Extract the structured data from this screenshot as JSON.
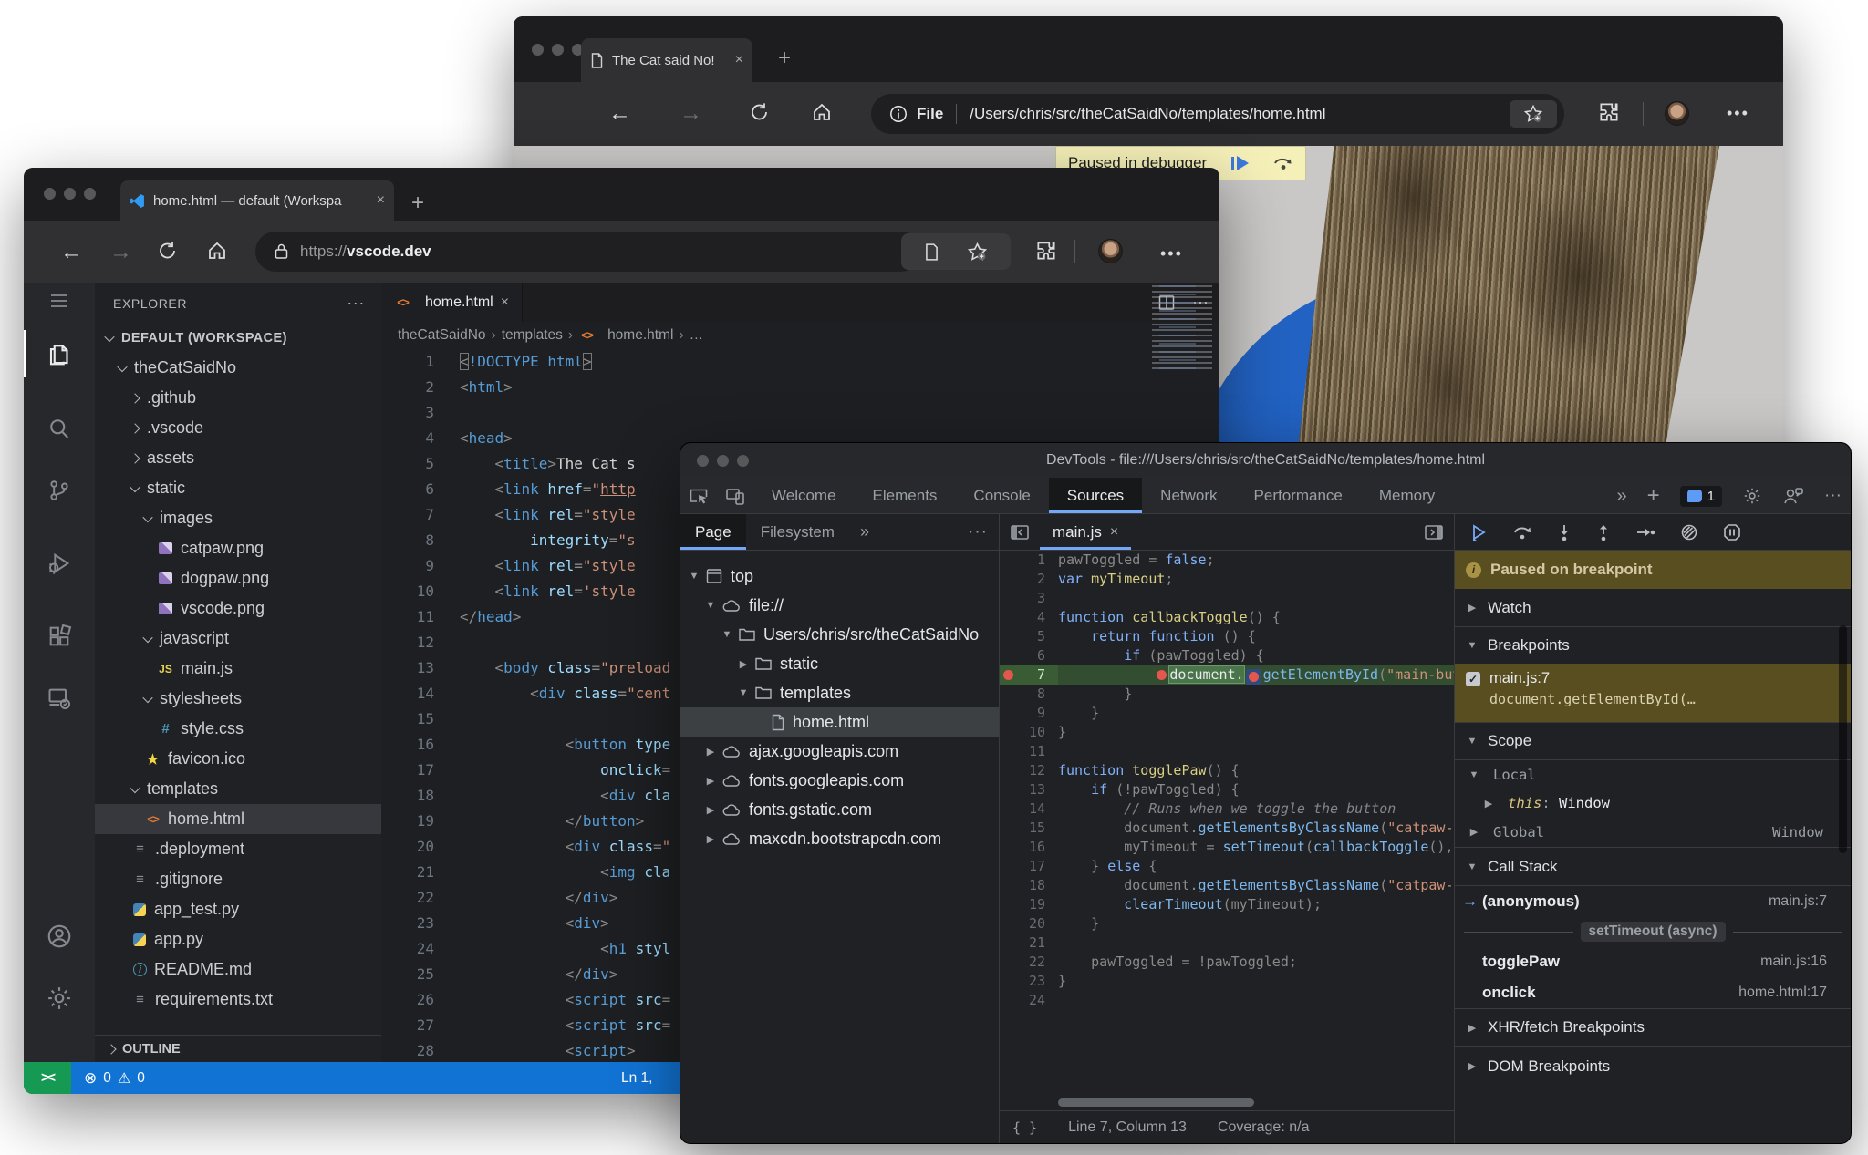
{
  "browser_top": {
    "tab_title": "The Cat said No!",
    "close_glyph": "×",
    "new_tab_glyph": "+",
    "address": {
      "scheme_label": "File",
      "path": "/Users/chris/src/theCatSaidNo/templates/home.html"
    },
    "banner": {
      "text": "Paused in debugger"
    },
    "menu_glyph": "•••"
  },
  "vscode_browser": {
    "tab_title": "home.html — default (Workspa",
    "close_glyph": "×",
    "new_tab_glyph": "+",
    "address": {
      "scheme": "https://",
      "host": "vscode.dev"
    },
    "menu_glyph": "•••"
  },
  "vscode": {
    "explorer_header": "EXPLORER",
    "header_menu_glyph": "···",
    "outline_label": "OUTLINE",
    "tree": [
      {
        "label": "DEFAULT (WORKSPACE)",
        "chev": "down",
        "indent": 0,
        "bold": true
      },
      {
        "label": "theCatSaidNo",
        "chev": "down",
        "indent": 1
      },
      {
        "label": ".github",
        "chev": "right",
        "indent": 2
      },
      {
        "label": ".vscode",
        "chev": "right",
        "indent": 2
      },
      {
        "label": "assets",
        "chev": "right",
        "indent": 2
      },
      {
        "label": "static",
        "chev": "down",
        "indent": 2
      },
      {
        "label": "images",
        "chev": "down",
        "indent": 3
      },
      {
        "label": "catpaw.png",
        "icon": "image",
        "indent": 4
      },
      {
        "label": "dogpaw.png",
        "icon": "image",
        "indent": 4
      },
      {
        "label": "vscode.png",
        "icon": "image",
        "indent": 4
      },
      {
        "label": "javascript",
        "chev": "down",
        "indent": 3
      },
      {
        "label": "main.js",
        "icon": "js",
        "indent": 4
      },
      {
        "label": "stylesheets",
        "chev": "down",
        "indent": 3
      },
      {
        "label": "style.css",
        "icon": "css",
        "indent": 4
      },
      {
        "label": "favicon.ico",
        "icon": "star",
        "indent": 3
      },
      {
        "label": "templates",
        "chev": "down",
        "indent": 2
      },
      {
        "label": "home.html",
        "icon": "html",
        "indent": 3,
        "selected": true
      },
      {
        "label": ".deployment",
        "icon": "list",
        "indent": 2
      },
      {
        "label": ".gitignore",
        "icon": "list",
        "indent": 2
      },
      {
        "label": "app_test.py",
        "icon": "py",
        "indent": 2
      },
      {
        "label": "app.py",
        "icon": "py",
        "indent": 2
      },
      {
        "label": "README.md",
        "icon": "info",
        "indent": 2
      },
      {
        "label": "requirements.txt",
        "icon": "list",
        "indent": 2
      }
    ],
    "editor": {
      "tab_label": "home.html",
      "tab_icon_glyph": "<>",
      "close_glyph": "×",
      "actions_menu_glyph": "···",
      "breadcrumbs": [
        "theCatSaidNo",
        "templates",
        "home.html",
        "…"
      ],
      "lines": [
        [
          [
            "b",
            "<"
          ],
          [
            "t",
            "!DOCTYPE"
          ],
          [
            "w",
            " "
          ],
          [
            "t",
            "html"
          ],
          [
            "b",
            ">"
          ]
        ],
        [
          [
            "p",
            "<"
          ],
          [
            "t",
            "html"
          ],
          [
            "p",
            ">"
          ]
        ],
        [],
        [
          [
            "p",
            "<"
          ],
          [
            "t",
            "head"
          ],
          [
            "p",
            ">"
          ]
        ],
        [
          [
            "w",
            "    "
          ],
          [
            "p",
            "<"
          ],
          [
            "t",
            "title"
          ],
          [
            "p",
            ">"
          ],
          [
            "w",
            "The Cat s"
          ]
        ],
        [
          [
            "w",
            "    "
          ],
          [
            "p",
            "<"
          ],
          [
            "t",
            "link"
          ],
          [
            "w",
            " "
          ],
          [
            "a",
            "href"
          ],
          [
            "p",
            "="
          ],
          [
            "s",
            "\""
          ],
          [
            "u",
            "http"
          ]
        ],
        [
          [
            "w",
            "    "
          ],
          [
            "p",
            "<"
          ],
          [
            "t",
            "link"
          ],
          [
            "w",
            " "
          ],
          [
            "a",
            "rel"
          ],
          [
            "p",
            "="
          ],
          [
            "s",
            "\"style"
          ]
        ],
        [
          [
            "w",
            "        "
          ],
          [
            "a",
            "integrity"
          ],
          [
            "p",
            "="
          ],
          [
            "s",
            "\"s"
          ]
        ],
        [
          [
            "w",
            "    "
          ],
          [
            "p",
            "<"
          ],
          [
            "t",
            "link"
          ],
          [
            "w",
            " "
          ],
          [
            "a",
            "rel"
          ],
          [
            "p",
            "="
          ],
          [
            "s",
            "\"style"
          ]
        ],
        [
          [
            "w",
            "    "
          ],
          [
            "p",
            "<"
          ],
          [
            "t",
            "link"
          ],
          [
            "w",
            " "
          ],
          [
            "a",
            "rel"
          ],
          [
            "p",
            "="
          ],
          [
            "s",
            "'style"
          ]
        ],
        [
          [
            "p",
            "</"
          ],
          [
            "t",
            "head"
          ],
          [
            "p",
            ">"
          ]
        ],
        [],
        [
          [
            "w",
            "    "
          ],
          [
            "p",
            "<"
          ],
          [
            "t",
            "body"
          ],
          [
            "w",
            " "
          ],
          [
            "a",
            "class"
          ],
          [
            "p",
            "="
          ],
          [
            "s",
            "\"preload"
          ]
        ],
        [
          [
            "w",
            "        "
          ],
          [
            "p",
            "<"
          ],
          [
            "t",
            "div"
          ],
          [
            "w",
            " "
          ],
          [
            "a",
            "class"
          ],
          [
            "p",
            "="
          ],
          [
            "s",
            "\"cent"
          ]
        ],
        [],
        [
          [
            "w",
            "            "
          ],
          [
            "p",
            "<"
          ],
          [
            "t",
            "button"
          ],
          [
            "w",
            " "
          ],
          [
            "a",
            "type"
          ]
        ],
        [
          [
            "w",
            "                "
          ],
          [
            "a",
            "onclick"
          ],
          [
            "p",
            "="
          ]
        ],
        [
          [
            "w",
            "                "
          ],
          [
            "p",
            "<"
          ],
          [
            "t",
            "div"
          ],
          [
            "w",
            " "
          ],
          [
            "a",
            "cla"
          ]
        ],
        [
          [
            "w",
            "            "
          ],
          [
            "p",
            "</"
          ],
          [
            "t",
            "button"
          ],
          [
            "p",
            ">"
          ]
        ],
        [
          [
            "w",
            "            "
          ],
          [
            "p",
            "<"
          ],
          [
            "t",
            "div"
          ],
          [
            "w",
            " "
          ],
          [
            "a",
            "class"
          ],
          [
            "p",
            "="
          ],
          [
            "s",
            "\""
          ]
        ],
        [
          [
            "w",
            "                "
          ],
          [
            "p",
            "<"
          ],
          [
            "t",
            "img"
          ],
          [
            "w",
            " "
          ],
          [
            "a",
            "cla"
          ]
        ],
        [
          [
            "w",
            "            "
          ],
          [
            "p",
            "</"
          ],
          [
            "t",
            "div"
          ],
          [
            "p",
            ">"
          ]
        ],
        [
          [
            "w",
            "            "
          ],
          [
            "p",
            "<"
          ],
          [
            "t",
            "div"
          ],
          [
            "p",
            ">"
          ]
        ],
        [
          [
            "w",
            "                "
          ],
          [
            "p",
            "<"
          ],
          [
            "t",
            "h1"
          ],
          [
            "w",
            " "
          ],
          [
            "a",
            "styl"
          ]
        ],
        [
          [
            "w",
            "            "
          ],
          [
            "p",
            "</"
          ],
          [
            "t",
            "div"
          ],
          [
            "p",
            ">"
          ]
        ],
        [
          [
            "w",
            "            "
          ],
          [
            "p",
            "<"
          ],
          [
            "t",
            "script"
          ],
          [
            "w",
            " "
          ],
          [
            "a",
            "src"
          ],
          [
            "p",
            "="
          ]
        ],
        [
          [
            "w",
            "            "
          ],
          [
            "p",
            "<"
          ],
          [
            "t",
            "script"
          ],
          [
            "w",
            " "
          ],
          [
            "a",
            "src"
          ],
          [
            "p",
            "="
          ]
        ],
        [
          [
            "w",
            "            "
          ],
          [
            "p",
            "<"
          ],
          [
            "t",
            "script"
          ],
          [
            "p",
            ">"
          ]
        ]
      ]
    },
    "status": {
      "remote_glyph": "><",
      "errors_icon": "⊗",
      "errors": "0",
      "warnings_icon": "⚠",
      "warnings": "0",
      "cursor": "Ln 1,"
    }
  },
  "devtools": {
    "title": "DevTools - file:///Users/chris/src/theCatSaidNo/templates/home.html",
    "tabs": [
      "Welcome",
      "Elements",
      "Console",
      "Sources",
      "Network",
      "Performance",
      "Memory"
    ],
    "active_tab": "Sources",
    "more_tabs_glyph": "»",
    "new_tab_glyph": "+",
    "issues_count": "1",
    "menu_glyph": "···",
    "navigator": {
      "tabs": [
        "Page",
        "Filesystem"
      ],
      "active_tab": "Page",
      "more_glyph": "»",
      "menu_glyph": "···",
      "tree": [
        {
          "label": "top",
          "chev": "down",
          "icon": "frame",
          "indent": 0
        },
        {
          "label": "file://",
          "chev": "down",
          "icon": "cloud",
          "indent": 1
        },
        {
          "label": "Users/chris/src/theCatSaidNo",
          "chev": "down",
          "icon": "folder",
          "indent": 2
        },
        {
          "label": "static",
          "chev": "right",
          "icon": "folder",
          "indent": 3
        },
        {
          "label": "templates",
          "chev": "down",
          "icon": "folder",
          "indent": 3
        },
        {
          "label": "home.html",
          "chev": "none",
          "icon": "file",
          "indent": 4,
          "selected": true
        },
        {
          "label": "ajax.googleapis.com",
          "chev": "right",
          "icon": "cloud",
          "indent": 1
        },
        {
          "label": "fonts.googleapis.com",
          "chev": "right",
          "icon": "cloud",
          "indent": 1
        },
        {
          "label": "fonts.gstatic.com",
          "chev": "right",
          "icon": "cloud",
          "indent": 1
        },
        {
          "label": "maxcdn.bootstrapcdn.com",
          "chev": "right",
          "icon": "cloud",
          "indent": 1
        }
      ]
    },
    "editor": {
      "tab_label": "main.js",
      "close_glyph": "×",
      "paused_line": 7,
      "lines": [
        [
          [
            "p",
            "pawToggled = "
          ],
          [
            "k",
            "false"
          ],
          [
            "p",
            ";"
          ]
        ],
        [
          [
            "k",
            "var"
          ],
          [
            "d",
            " myTimeout"
          ],
          [
            "p",
            ";"
          ]
        ],
        [],
        [
          [
            "k",
            "function"
          ],
          [
            "d",
            " callbackToggle"
          ],
          [
            "p",
            "() {"
          ]
        ],
        [
          [
            "p",
            "    "
          ],
          [
            "k",
            "return"
          ],
          [
            "p",
            " "
          ],
          [
            "k",
            "function"
          ],
          [
            "p",
            " () {"
          ]
        ],
        [
          [
            "p",
            "        "
          ],
          [
            "k",
            "if"
          ],
          [
            "p",
            " (pawToggled) {"
          ]
        ],
        [
          [
            "p",
            "            "
          ],
          [
            "dot",
            ""
          ],
          [
            "hl",
            "document."
          ],
          [
            "dot2",
            ""
          ],
          [
            "f",
            "getElementById"
          ],
          [
            "p",
            "("
          ],
          [
            "s",
            "\"main-but"
          ]
        ],
        [
          [
            "p",
            "        }"
          ]
        ],
        [
          [
            "p",
            "    }"
          ]
        ],
        [
          [
            "p",
            "}"
          ]
        ],
        [],
        [
          [
            "k",
            "function"
          ],
          [
            "d",
            " togglePaw"
          ],
          [
            "p",
            "() {"
          ]
        ],
        [
          [
            "p",
            "    "
          ],
          [
            "k",
            "if"
          ],
          [
            "p",
            " (!pawToggled) {"
          ]
        ],
        [
          [
            "c",
            "        // Runs when we toggle the button"
          ]
        ],
        [
          [
            "p",
            "        document."
          ],
          [
            "f",
            "getElementsByClassName"
          ],
          [
            "p",
            "("
          ],
          [
            "s",
            "\"catpaw-"
          ]
        ],
        [
          [
            "p",
            "        myTimeout = "
          ],
          [
            "f",
            "setTimeout"
          ],
          [
            "p",
            "("
          ],
          [
            "f",
            "callbackToggle"
          ],
          [
            "p",
            "(),"
          ]
        ],
        [
          [
            "p",
            "    } "
          ],
          [
            "k",
            "else"
          ],
          [
            "p",
            " {"
          ]
        ],
        [
          [
            "p",
            "        document."
          ],
          [
            "f",
            "getElementsByClassName"
          ],
          [
            "p",
            "("
          ],
          [
            "s",
            "\"catpaw-"
          ]
        ],
        [
          [
            "p",
            "        "
          ],
          [
            "f",
            "clearTimeout"
          ],
          [
            "p",
            "(myTimeout);"
          ]
        ],
        [
          [
            "p",
            "    }"
          ]
        ],
        [],
        [
          [
            "p",
            "    pawToggled = !pawToggled;"
          ]
        ],
        [
          [
            "p",
            "}"
          ]
        ],
        []
      ],
      "status": {
        "brackets": "{ }",
        "position": "Line 7, Column 13",
        "coverage": "Coverage: n/a"
      }
    },
    "debugger": {
      "paused_message": "Paused on breakpoint",
      "watch_label": "Watch",
      "breakpoints_label": "Breakpoints",
      "breakpoint": {
        "checked_glyph": "✓",
        "location": "main.js:7",
        "code": "document.getElementById(…"
      },
      "scope_label": "Scope",
      "scope": {
        "local_label": "Local",
        "this_name": "this",
        "this_sep": ": ",
        "this_value": "Window",
        "global_label": "Global",
        "global_value": "Window"
      },
      "callstack_label": "Call Stack",
      "active_frame_glyph": "→",
      "frames": [
        {
          "name": "(anonymous)",
          "location": "main.js:7",
          "active": true
        },
        {
          "separator": "setTimeout (async)"
        },
        {
          "name": "togglePaw",
          "location": "main.js:16"
        },
        {
          "name": "onclick",
          "location": "home.html:17"
        }
      ],
      "xhr_label": "XHR/fetch Breakpoints",
      "dom_label": "DOM Breakpoints"
    }
  }
}
